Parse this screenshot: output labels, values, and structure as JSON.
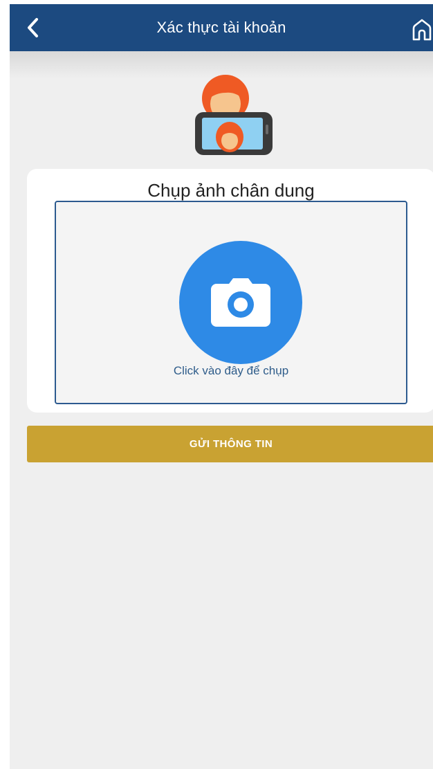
{
  "header": {
    "title": "Xác thực tài khoản",
    "back_icon": "chevron-left-icon",
    "home_icon": "home-icon"
  },
  "illustration": {
    "icon": "selfie-phone-icon"
  },
  "portrait_card": {
    "title": "Chụp ảnh chân dung",
    "capture_hint": "Click vào đây để chụp",
    "camera_icon": "camera-icon"
  },
  "submit_button": {
    "label": "GỬI THÔNG TIN"
  },
  "colors": {
    "header_bg": "#1c4a80",
    "accent_blue": "#2e8ae6",
    "submit_bg": "#c9a232",
    "page_bg": "#efefef"
  }
}
